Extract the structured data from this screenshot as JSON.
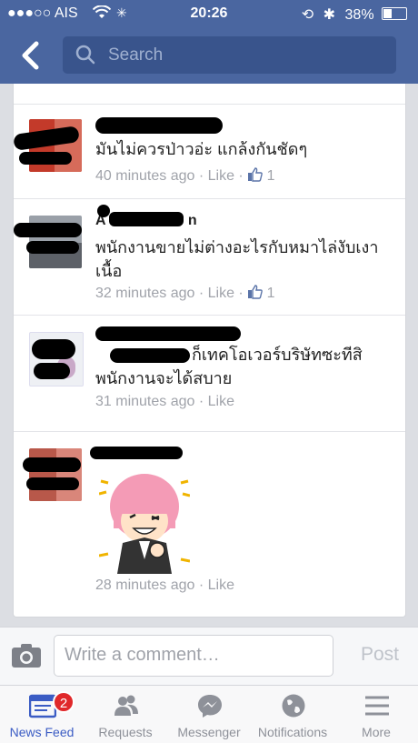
{
  "status": {
    "carrier": "●●●○○ AIS",
    "time": "20:26",
    "battery": "38%"
  },
  "nav": {
    "search_placeholder": "Search"
  },
  "comments": [
    {
      "text": "มันไม่ควรป่าวอ่ะ แกล้งกันชัดๆ",
      "time": "40 minutes ago",
      "like": "Like",
      "likes": "1"
    },
    {
      "name_part": "A",
      "name_end": "n",
      "text": "พนักงานขายไม่ต่างอะไรกับหมาไล่งับเงาเนื้อ",
      "time": "32 minutes ago",
      "like": "Like",
      "likes": "1"
    },
    {
      "text": "ก็เทคโอเวอร์บริษัทซะทีสิ พนักงานจะได้สบาย",
      "time": "31 minutes ago",
      "like": "Like"
    },
    {
      "time": "28 minutes ago",
      "like": "Like"
    }
  ],
  "comment_bar": {
    "placeholder": "Write a comment…",
    "post": "Post"
  },
  "tabs": [
    {
      "label": "News Feed",
      "badge": "2",
      "icon": "news-feed-icon"
    },
    {
      "label": "Requests",
      "icon": "requests-icon"
    },
    {
      "label": "Messenger",
      "icon": "messenger-icon"
    },
    {
      "label": "Notifications",
      "icon": "globe-icon"
    },
    {
      "label": "More",
      "icon": "menu-icon"
    }
  ],
  "colors": {
    "fb_blue": "#4a66a0",
    "active_tab": "#3b5cc4",
    "badge": "#e0282a"
  }
}
